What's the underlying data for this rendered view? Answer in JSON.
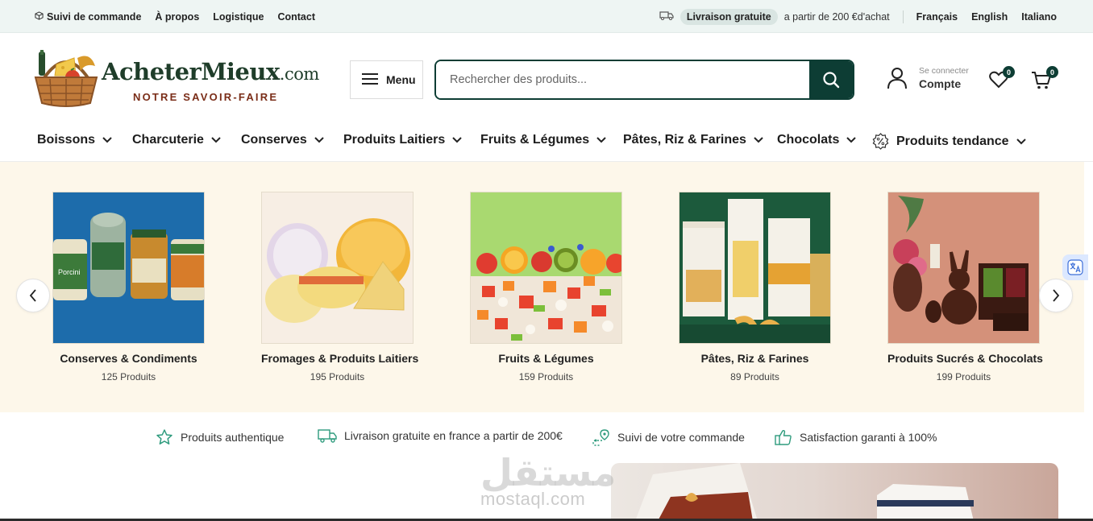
{
  "topbar": {
    "links": [
      "Suivi de commande",
      "À propos",
      "Logistique",
      "Contact"
    ],
    "promo_pill": "Livraison gratuite",
    "promo_text": "a partir de 200 €d'achat",
    "languages": [
      "Français",
      "English",
      "Italiano"
    ]
  },
  "header": {
    "logo_name": "AcheterMieux",
    "logo_domain": ".com",
    "logo_tagline": "NOTRE SAVOIR-FAIRE",
    "menu_label": "Menu",
    "search_placeholder": "Rechercher des produits...",
    "account_small": "Se connecter",
    "account_label": "Compte",
    "wishlist_count": "0",
    "cart_count": "0"
  },
  "categories": [
    "Boissons",
    "Charcuterie",
    "Conserves",
    "Produits Laitiers",
    "Fruits & Légumes",
    "Pâtes, Riz & Farines",
    "Chocolats",
    "Produits tendance"
  ],
  "carousel": {
    "items": [
      {
        "name": "Conserves & Condiments",
        "count": "125 Produits"
      },
      {
        "name": "Fromages & Produits Laitiers",
        "count": "195 Produits"
      },
      {
        "name": "Fruits & Légumes",
        "count": "159 Produits"
      },
      {
        "name": "Pâtes, Riz & Farines",
        "count": "89 Produits"
      },
      {
        "name": "Produits Sucrés & Chocolats",
        "count": "199 Produits"
      }
    ]
  },
  "features": [
    "Produits authentique",
    "Livraison gratuite en france a partir de 200€",
    "Suivi de votre commande",
    "Satisfaction garanti à 100%"
  ],
  "watermark": {
    "arabic": "مستقل",
    "latin": "mostaql.com"
  },
  "colors": {
    "brand_dark": "#0d3d34",
    "accent_green": "#2e9b7d",
    "carousel_bg": "#fdf7ea"
  }
}
